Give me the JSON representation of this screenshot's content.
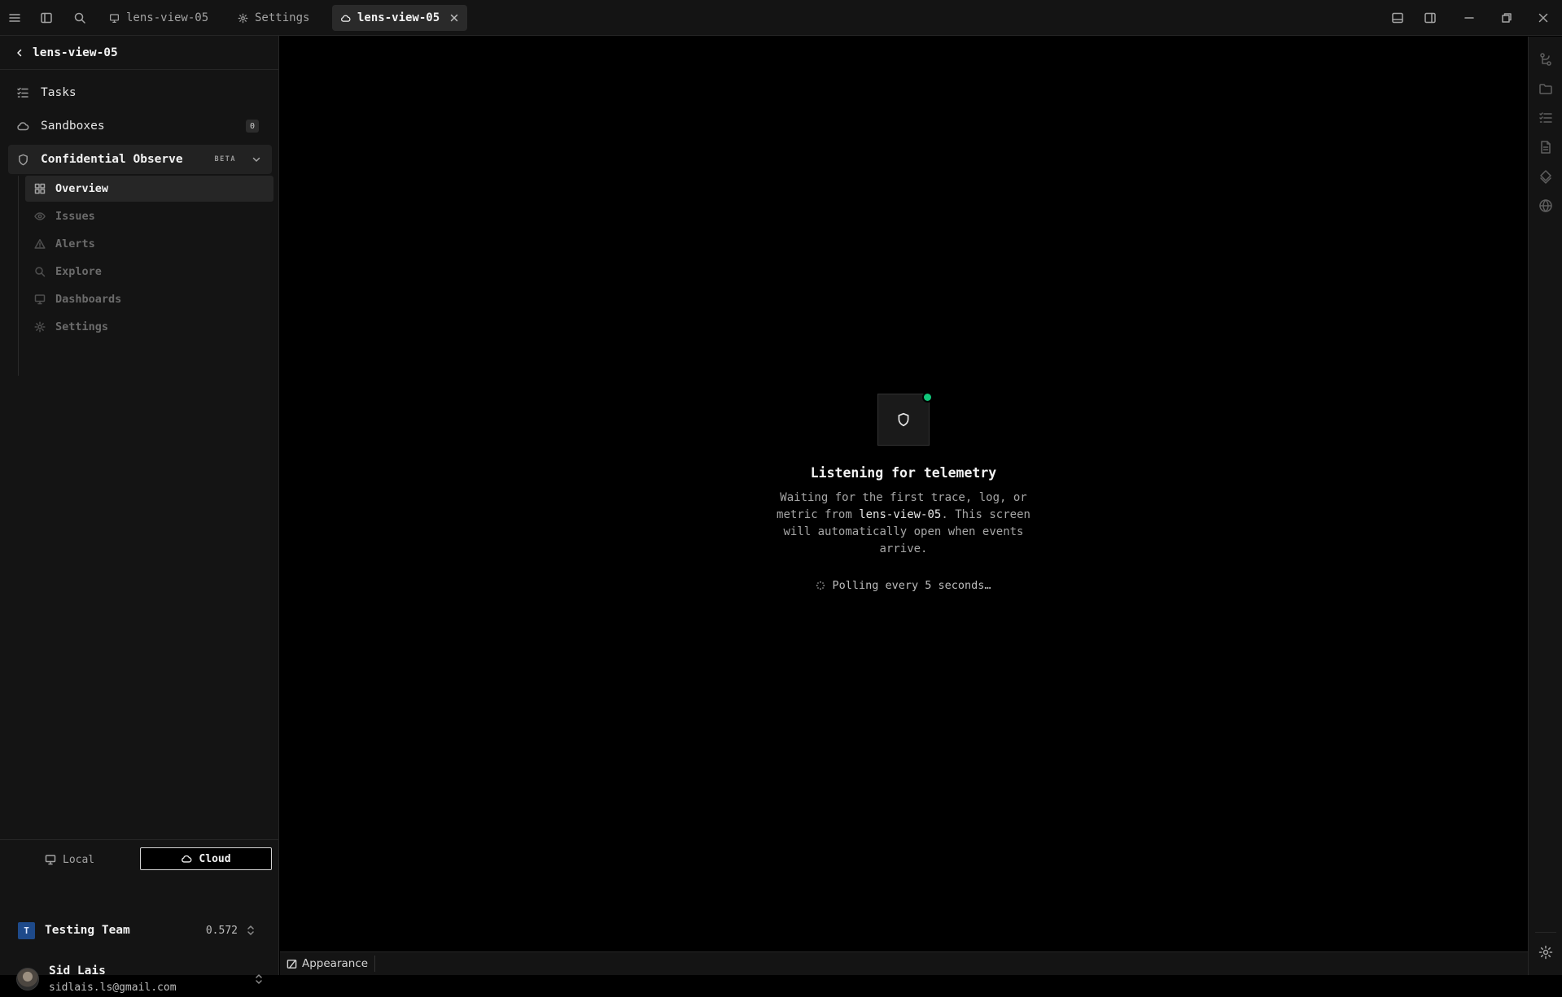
{
  "titlebar": {
    "tabs": [
      {
        "label": "lens-view-05",
        "icon": "monitor-icon"
      },
      {
        "label": "Settings",
        "icon": "gear-icon"
      },
      {
        "label": "lens-view-05",
        "icon": "cloud-icon",
        "active": true
      }
    ]
  },
  "sidebar": {
    "back_title": "lens-view-05",
    "items": [
      {
        "label": "Tasks",
        "icon": "tasks-icon"
      },
      {
        "label": "Sandboxes",
        "icon": "cloud-icon",
        "badge": "0"
      }
    ],
    "section": {
      "label": "Confidential Observe",
      "badge": "BETA",
      "icon": "shield-icon"
    },
    "sub_items": [
      {
        "label": "Overview",
        "icon": "grid-icon",
        "active": true
      },
      {
        "label": "Issues",
        "icon": "eye-icon"
      },
      {
        "label": "Alerts",
        "icon": "alert-triangle-icon"
      },
      {
        "label": "Explore",
        "icon": "search-icon"
      },
      {
        "label": "Dashboards",
        "icon": "monitor-icon"
      },
      {
        "label": "Settings",
        "icon": "gear-icon"
      }
    ],
    "mode_toggle": {
      "local": "Local",
      "cloud": "Cloud",
      "selected": "Cloud"
    },
    "team": {
      "initial": "T",
      "name": "Testing Team",
      "version": "0.572"
    },
    "user": {
      "name": "Sid Lais",
      "email": "sidlais.ls@gmail.com"
    }
  },
  "main": {
    "empty_state": {
      "title": "Listening for telemetry",
      "desc_before": "Waiting for the first trace, log, or metric from ",
      "desc_highlight": "lens-view-05",
      "desc_after": ". This screen will automatically open when events arrive.",
      "polling": "Polling every 5 seconds…",
      "status_color": "#10c77a"
    }
  },
  "statusbar": {
    "appearance": "Appearance"
  }
}
